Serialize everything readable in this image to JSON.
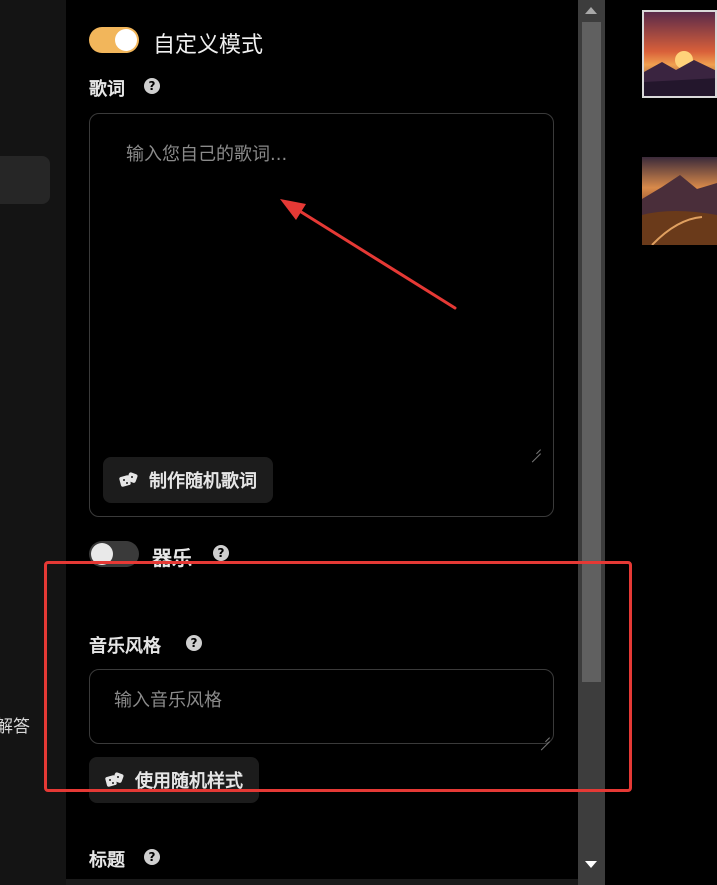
{
  "sidebar": {
    "partial_text": "解答"
  },
  "form": {
    "custom_mode": {
      "label": "自定义模式",
      "enabled": true
    },
    "lyrics": {
      "label": "歌词",
      "placeholder": "输入您自己的歌词...",
      "random_button": "制作随机歌词"
    },
    "instrumental": {
      "label": "器乐",
      "enabled": false
    },
    "music_style": {
      "label": "音乐风格",
      "placeholder": "输入音乐风格",
      "random_button": "使用随机样式"
    },
    "title": {
      "label": "标题"
    }
  },
  "colors": {
    "accent": "#f2b65b",
    "annotation": "#e53935",
    "background": "#000000"
  },
  "icons": {
    "help": "question-circle-icon",
    "random": "dice-icon"
  }
}
